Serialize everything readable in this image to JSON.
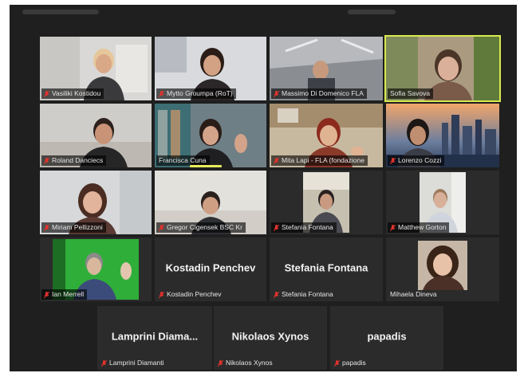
{
  "participants": [
    {
      "name": "Vasiliki Kostidou"
    },
    {
      "name": "Mytto Groumpa (RoT)"
    },
    {
      "name": "Massimo Di Domenico FLA"
    },
    {
      "name": "Sofia Savova"
    },
    {
      "name": "Roland Danciecs"
    },
    {
      "name": "Francisca Cuna"
    },
    {
      "name": "Mita Lapi - FLA (fondazione"
    },
    {
      "name": "Lorenzo Cozzi"
    },
    {
      "name": "Miriam Pellizzoni"
    },
    {
      "name": "Gregor Cigensek BSC Kr"
    },
    {
      "name": "Stefania Fontana"
    },
    {
      "name": "Matthew Gorton"
    },
    {
      "name": "Ian Merrell"
    },
    {
      "name": "Kostadin Penchev",
      "display": "Kostadin Penchev"
    },
    {
      "name": "Stefania Fontana",
      "display": "Stefania Fontana"
    },
    {
      "name": "Mihaela Dineva"
    },
    {
      "name": "Lamprini Diamanti",
      "display": "Lamprini  Diama..."
    },
    {
      "name": "Nikolaos Xynos",
      "display": "Nikolaos Xynos"
    },
    {
      "name": "papadis",
      "display": "papadis"
    }
  ],
  "colors": {
    "background": "#1f1f1f",
    "active_speaker_border": "#d8e94f",
    "muted_icon": "#e0332c"
  },
  "icons": {
    "muted": "mic-muted-icon"
  }
}
